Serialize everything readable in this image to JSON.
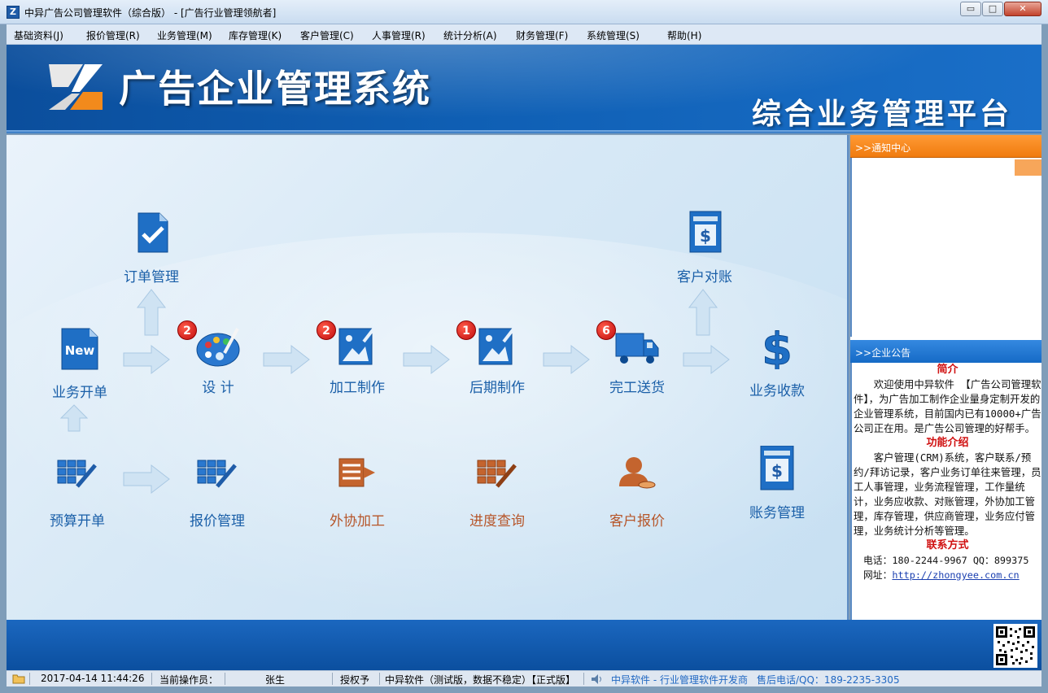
{
  "window": {
    "title": "中异广告公司管理软件（综合版） - [广告行业管理领航者]",
    "controls": {
      "minimize": "▭",
      "maximize": "□",
      "close": "✕"
    }
  },
  "menu": [
    {
      "label": "基础资料(J)"
    },
    {
      "label": "报价管理(R)"
    },
    {
      "label": "业务管理(M)"
    },
    {
      "label": "库存管理(K)"
    },
    {
      "label": "客户管理(C)"
    },
    {
      "label": "人事管理(R)"
    },
    {
      "label": "统计分析(A)"
    },
    {
      "label": "财务管理(F)"
    },
    {
      "label": "系统管理(S)"
    },
    {
      "label": "帮助(H)"
    }
  ],
  "banner": {
    "title": "广告企业管理系统",
    "subtitle": "综合业务管理平台"
  },
  "workflow": {
    "order": {
      "label": "订单管理",
      "icon": "order-check-icon"
    },
    "new_business": {
      "label": "业务开单",
      "icon": "new-document-icon"
    },
    "design": {
      "label": "设 计",
      "icon": "palette-icon",
      "badge": "2"
    },
    "processing": {
      "label": "加工制作",
      "icon": "image-edit-icon",
      "badge": "2"
    },
    "post_production": {
      "label": "后期制作",
      "icon": "image-edit-icon",
      "badge": "1"
    },
    "delivery": {
      "label": "完工送货",
      "icon": "truck-icon",
      "badge": "6"
    },
    "reconcile": {
      "label": "客户对账",
      "icon": "dollar-document-icon"
    },
    "collection": {
      "label": "业务收款",
      "icon": "dollar-sign-icon"
    },
    "budget": {
      "label": "预算开单",
      "icon": "calculator-icon"
    },
    "quote": {
      "label": "报价管理",
      "icon": "calculator-icon"
    },
    "outsource": {
      "label": "外协加工",
      "icon": "outsource-doc-icon"
    },
    "progress": {
      "label": "进度查询",
      "icon": "calculator-edit-icon"
    },
    "customer_quote": {
      "label": "客户报价",
      "icon": "user-icon"
    },
    "accounts": {
      "label": "账务管理",
      "icon": "dollar-document-icon"
    }
  },
  "notice": {
    "header": ">>通知中心"
  },
  "announcement": {
    "header": ">>企业公告",
    "intro_title": "简介",
    "intro_text": "欢迎使用中异软件 【广告公司管理软件】，为广告加工制作企业量身定制开发的企业管理系统，目前国内已有10000+广告公司正在用。是广告公司管理的好帮手。",
    "features_title": "功能介绍",
    "features_text": "客户管理(CRM)系统，客户联系/预约/拜访记录，客户业务订单往来管理，员工人事管理，业务流程管理，工作量统计，业务应收款、对账管理，外协加工管理，库存管理，供应商管理，业务应付管理，业务统计分析等管理。",
    "contact_title": "联系方式",
    "phone_line": "电话：180-2244-9967  QQ：899375",
    "website_label": "网址：",
    "website": "http://zhongyee.com.cn"
  },
  "status": {
    "datetime": "2017-04-14 11:44:26",
    "operator_label": "当前操作员：",
    "operator": "张生",
    "license_label": "授权予",
    "license": "中异软件（测试版，数据不稳定）【正式版】",
    "vendor": "中异软件 - 行业管理软件开发商",
    "support": "售后电话/QQ：189-2235-3305"
  },
  "colors": {
    "accent": "#0f5fb4",
    "notice": "#f07b0f",
    "badge": "#c10c0c",
    "label_blue": "#1a5fa8",
    "label_orange": "#b6562a"
  }
}
